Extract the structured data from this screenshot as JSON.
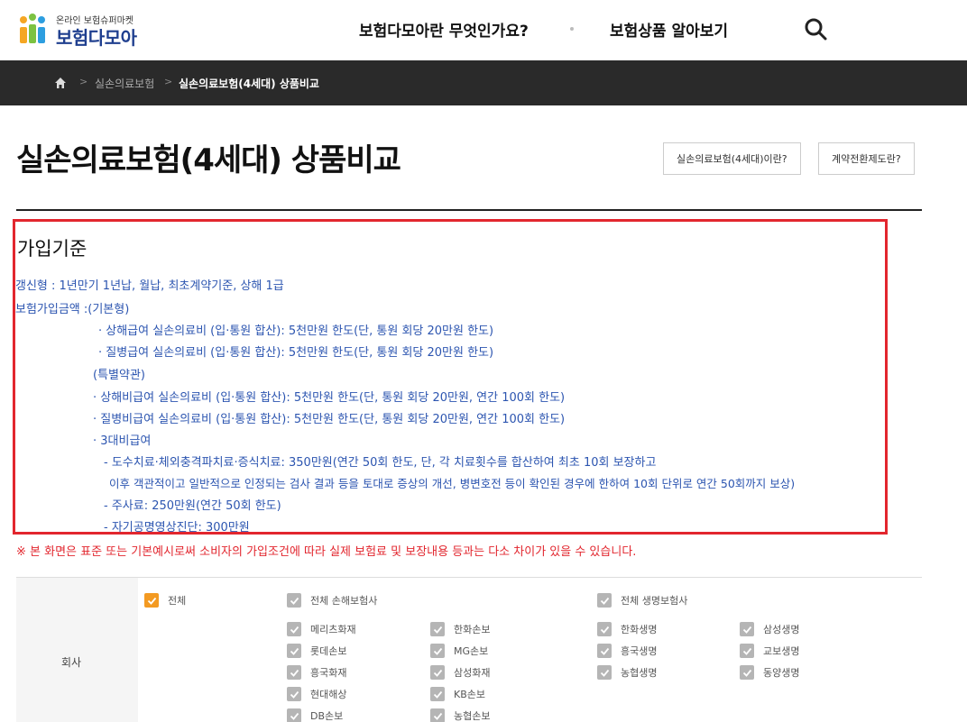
{
  "header": {
    "logo_sub": "온라인 보험슈퍼마켓",
    "logo_main": "보험다모아",
    "nav": [
      "보험다모아란 무엇인가요?",
      "보험상품 알아보기"
    ]
  },
  "breadcrumb": {
    "level1": "실손의료보험",
    "current": "실손의료보험(4세대) 상품비교"
  },
  "page": {
    "title": "실손의료보험(4세대) 상품비교",
    "btn_about": "실손의료보험(4세대)이란?",
    "btn_switch": "계약전환제도란?"
  },
  "criteria": {
    "title": "가입기준",
    "lines": [
      "갱신형 : 1년만기 1년납, 월납, 최초계약기준, 상해 1급",
      "보험가입금액 :(기본형)",
      "· 상해급여 실손의료비 (입·통원 합산): 5천만원 한도(단, 통원 회당 20만원 한도)",
      "· 질병급여 실손의료비 (입·통원 합산): 5천만원 한도(단, 통원 회당 20만원 한도)",
      "(특별약관)",
      "· 상해비급여 실손의료비 (입·통원 합산): 5천만원 한도(단, 통원 회당 20만원, 연간 100회 한도)",
      "· 질병비급여 실손의료비 (입·통원 합산): 5천만원 한도(단, 통원 회당 20만원, 연간 100회 한도)",
      "· 3대비급여",
      "- 도수치료·체외충격파치료·증식치료: 350만원(연간 50회 한도, 단, 각 치료횟수를 합산하여 최초 10회 보장하고",
      "이후 객관적이고 일반적으로 인정되는 검사 결과 등을 토대로 증상의 개선, 병변호전 등이 확인된 경우에 한하여 10회 단위로 연간 50회까지 보상)",
      "- 주사료: 250만원(연간 50회 한도)",
      "- 자기공명영상진단: 300만원"
    ]
  },
  "notice": "※ 본 화면은 표준 또는 기본예시로써 소비자의 가입조건에 따라 실제 보험료 및 보장내용 등과는 다소 차이가 있을 수 있습니다.",
  "filter": {
    "label": "회사",
    "all": "전체",
    "all_nonlife": "전체 손해보험사",
    "all_life": "전체 생명보험사",
    "nonlife": [
      "메리츠화재",
      "한화손보",
      "롯데손보",
      "MG손보",
      "흥국화재",
      "삼성화재",
      "현대해상",
      "KB손보",
      "DB손보",
      "농협손보"
    ],
    "life": [
      "한화생명",
      "삼성생명",
      "흥국생명",
      "교보생명",
      "농협생명",
      "동양생명"
    ]
  },
  "colors": {
    "accent_red": "#e2262e",
    "link_blue": "#2c55b0",
    "check_orange": "#f39a22",
    "check_gray": "#b5b5b5",
    "bar_dark": "#2a2a2a"
  },
  "icons": [
    "logo-mark-icon",
    "search-icon",
    "home-icon",
    "chevron-right-icon",
    "checkbox-check-icon"
  ]
}
